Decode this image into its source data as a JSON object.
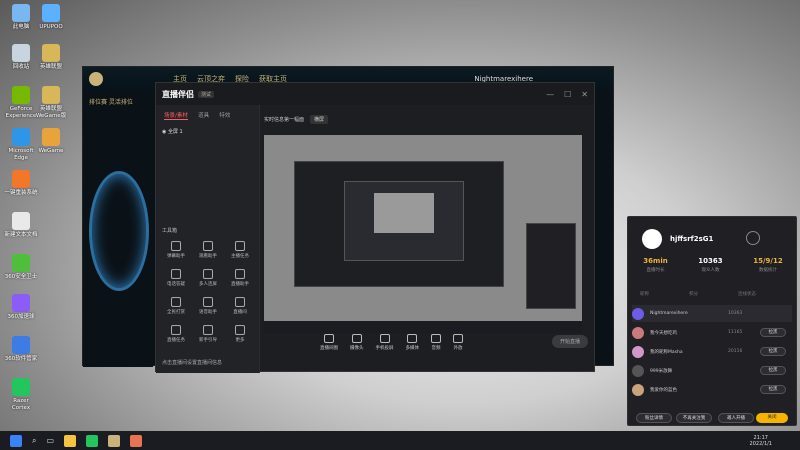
{
  "desktop": {
    "icons": [
      {
        "label": "此电脑",
        "color": "#7ab6f0"
      },
      {
        "label": "UPUPOO",
        "color": "#5bb0ff"
      },
      {
        "label": "回收站",
        "color": "#c8d5e0"
      },
      {
        "label": "英雄联盟",
        "color": "#d8b75a"
      },
      {
        "label": "GeForce Experience",
        "color": "#76b900"
      },
      {
        "label": "英雄联盟WeGame版",
        "color": "#d8b75a"
      },
      {
        "label": "Microsoft Edge",
        "color": "#2f95e8"
      },
      {
        "label": "WeGame",
        "color": "#e7a43a"
      },
      {
        "label": "一键重装系统",
        "color": "#f2772a"
      },
      {
        "label": "新建文本文档",
        "color": "#e9e9e9"
      },
      {
        "label": "360安全卫士",
        "color": "#4fbf3b"
      },
      {
        "label": "360加速球",
        "color": "#8b5cf6"
      },
      {
        "label": "360软件管家",
        "color": "#3d7be5"
      },
      {
        "label": "Razer Cortex",
        "color": "#22c55e"
      }
    ]
  },
  "lol_client": {
    "nav": [
      "主页",
      "云顶之弈",
      "探险",
      "获取主页"
    ],
    "username": "Nightmarexihere",
    "panel_title": "排位赛 灵活排位"
  },
  "stream_app": {
    "title": "直播伴侣",
    "version": "测试",
    "left_tabs": [
      "场景/素材",
      "道具",
      "特效"
    ],
    "scene": "全屏 1",
    "live_title": "实时信息第一幅面",
    "tag": "横屏",
    "tools_header": "工具箱",
    "tools": [
      "弹幕助手",
      "观看助手",
      "主播任务",
      "电话答疑",
      "多人连屏",
      "直播助手",
      "全民打赏",
      "语音助手",
      "直播间",
      "直播任务",
      "新手引导",
      "更多"
    ],
    "bottom_actions": [
      "直播间图",
      "摄像头",
      "手机投屏",
      "多媒体",
      "音频",
      "外放"
    ],
    "start_label": "开始直播",
    "footer_note": "点击直播间设置直播间信息"
  },
  "popup": {
    "name": "hjffsrf2sG1",
    "stats": [
      {
        "value": "36min",
        "label": "直播时长",
        "color": "#e8b53f"
      },
      {
        "value": "10363",
        "label": "观众人数",
        "color": "#ffffff"
      },
      {
        "value": "15/9/12",
        "label": "数据统计",
        "color": "#e8b53f"
      }
    ],
    "cols": [
      "昵称",
      "积分",
      "连线状态"
    ],
    "rows": [
      {
        "name": "Nightmarexihere",
        "score": "10363",
        "action": "",
        "avatar": "#6c5ce7"
      },
      {
        "name": "我今天想吃鸡",
        "score": "11165",
        "action": "拉黑",
        "avatar": "#c97b7b"
      },
      {
        "name": "我的昵称Masha",
        "score": "20116",
        "action": "拉黑",
        "avatar": "#d098c8"
      },
      {
        "name": "999米放舞",
        "score": "",
        "action": "拉黑",
        "avatar": "#555555"
      },
      {
        "name": "我爱你的蓝色",
        "score": "",
        "action": "拉黑",
        "avatar": "#c9a37b"
      }
    ],
    "footer_buttons": [
      "粉丝详情",
      "不再关注我",
      "邀人开播",
      "关闭"
    ]
  },
  "taskbar": {
    "time": "21:17",
    "date": "2022/1/1"
  }
}
